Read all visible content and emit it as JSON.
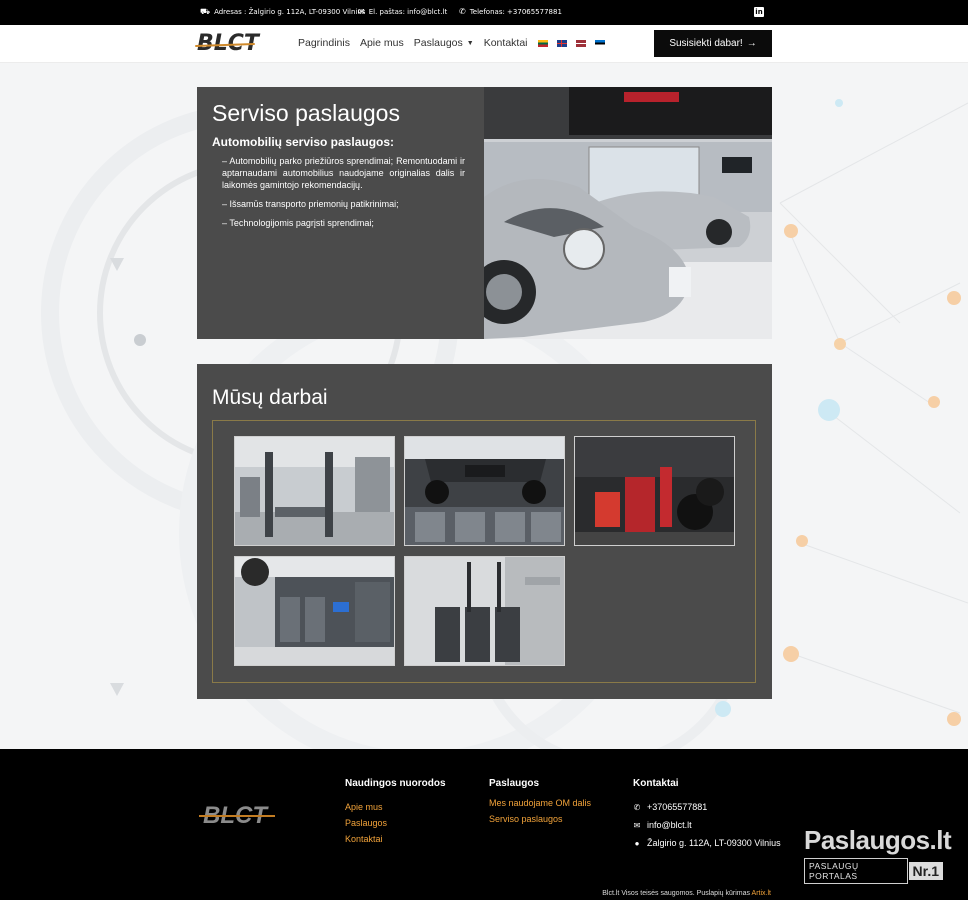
{
  "topbar": {
    "address": "Adresas : Žalgirio g. 112A, LT-09300 Vilnius",
    "email": "El. paštas: info@blct.lt",
    "phone": "Telefonas: +37065577881",
    "social_icon": "linkedin-icon",
    "linkedin_letters": "in"
  },
  "header": {
    "logo": "BLCT",
    "nav": [
      "Pagrindinis",
      "Apie mus",
      "Paslaugos",
      "Kontaktai"
    ],
    "dropdown_caret": "▼",
    "languages": [
      "lt",
      "en",
      "lv",
      "ee"
    ],
    "cta_label": "Susisiekti dabar!",
    "cta_icon": "→"
  },
  "service": {
    "title": "Serviso paslaugos",
    "subtitle": "Automobilių serviso paslaugos:",
    "items": [
      "– Automobilių parko priežiūros sprendimai; Remontuodami ir aptarnaudami automobilius naudojame originalias dalis ir laikomės gamintojo rekomendacijų.",
      "– Išsamūs transporto priemonių patikrinimai;",
      "– Technologijomis pagrįsti sprendimai;"
    ]
  },
  "works": {
    "title": "Mūsų darbai"
  },
  "footer": {
    "logo": "BLCT",
    "col1": {
      "title": "Naudingos nuorodos",
      "links": [
        "Apie mus",
        "Paslaugos",
        "Kontaktai"
      ]
    },
    "col2": {
      "title": "Paslaugos",
      "links": [
        "Mes naudojame OM dalis",
        "Serviso paslaugos"
      ]
    },
    "col3": {
      "title": "Kontaktai",
      "phone": "+37065577881",
      "email": "info@blct.lt",
      "address": "Žalgirio g. 112A, LT-09300 Vilnius"
    },
    "copyright": "Blct.lt Visos teisės saugomos. Puslapių kūrimas",
    "artix": "Artix.lt"
  },
  "badge": {
    "top": "Paslaugos.lt",
    "portal": "PASLAUGŲ PORTALAS",
    "nr": "Nr.1"
  },
  "colors": {
    "accent": "#f2a33a",
    "panel": "#4b4b4b",
    "footer": "#000000"
  }
}
